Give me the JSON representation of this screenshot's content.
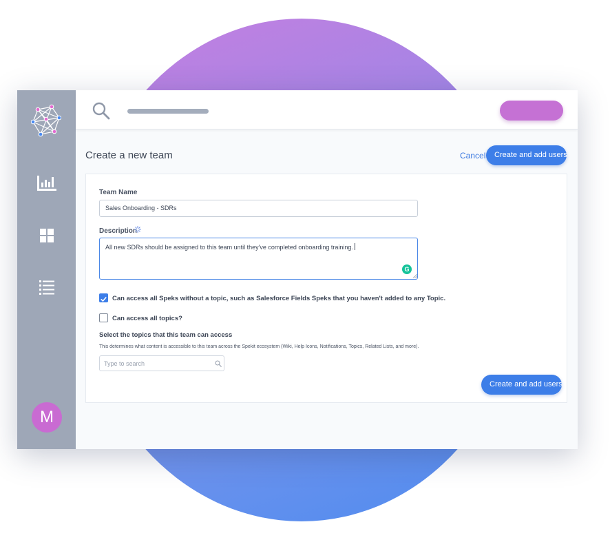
{
  "colors": {
    "accent": "#3d7ee8",
    "sidebar": "#9ea7b7",
    "avatar": "#c96bd2",
    "top_pill": "#c571d4",
    "grammarly": "#15c39a"
  },
  "icons": {
    "logo": "network-logo-icon",
    "nav": [
      "bar-chart-icon",
      "grid-icon",
      "list-icon"
    ],
    "search": "search-icon",
    "description_hint": "sparkle-icon",
    "grammarly": "grammarly-icon",
    "topic_search": "search-icon"
  },
  "sidebar": {
    "avatar_initial": "M"
  },
  "header": {
    "title": "Create a new team",
    "cancel_label": "Cancel",
    "primary_label": "Create and add users"
  },
  "form": {
    "team_name_label": "Team Name",
    "team_name_value": "Sales Onboarding - SDRs",
    "description_label": "Description",
    "description_value": "All new SDRs should be assigned to this team until they've completed onboarding training.",
    "grammarly_letter": "G",
    "checkboxes": [
      {
        "label": "Can access all Speks without a topic, such as Salesforce Fields Speks that you haven't added to any Topic.",
        "checked": true
      },
      {
        "label": "Can access all topics?",
        "checked": false
      }
    ],
    "topics_title": "Select the topics that this team can access",
    "topics_description": "This determines what content is accessible to this team across the Spekit ecosystem (Wiki, Help Icons, Notifications, Topics, Related Lists, and more).",
    "topics_search_placeholder": "Type to search",
    "submit_label": "Create and add users"
  }
}
